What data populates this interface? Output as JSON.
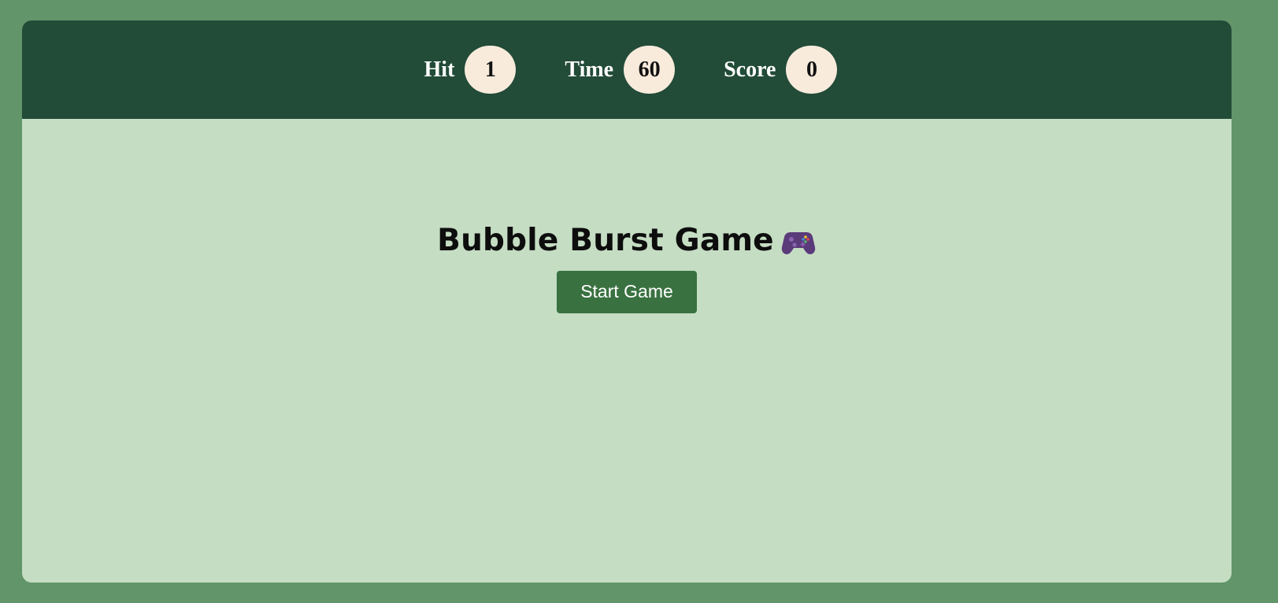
{
  "stats": [
    {
      "label": "Hit",
      "value": "1"
    },
    {
      "label": "Time",
      "value": "60"
    },
    {
      "label": "Score",
      "value": "0"
    }
  ],
  "game": {
    "title": "Bubble Burst Game",
    "title_icon": "game-controller-icon",
    "start_label": "Start Game"
  },
  "colors": {
    "page_background": "#62956a",
    "header_background": "#224b38",
    "panel_background": "#c5ddc3",
    "stat_box_background": "#f8ebdc",
    "button_background": "#3a7141",
    "controller_color": "#5b3a7a"
  }
}
